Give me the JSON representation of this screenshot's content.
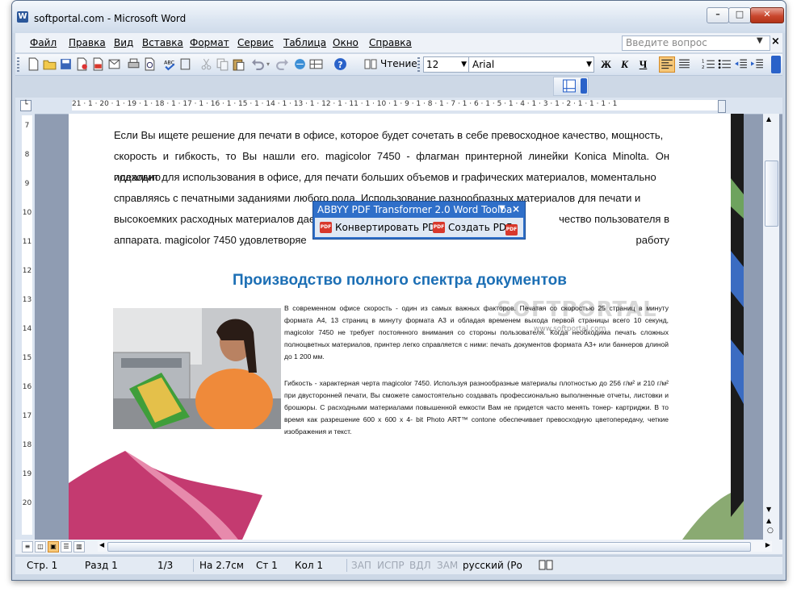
{
  "window": {
    "title": "softportal.com - Microsoft Word",
    "app_icon": "W"
  },
  "caption_buttons": {
    "minimize": "–",
    "maximize": "□",
    "close": "✕"
  },
  "menu": {
    "items": [
      "Файл",
      "Правка",
      "Вид",
      "Вставка",
      "Формат",
      "Сервис",
      "Таблица",
      "Окно",
      "Справка"
    ],
    "help_placeholder": "Введите вопрос",
    "close_doc": "×"
  },
  "toolbar": {
    "reading_label": "Чтение",
    "font_size": "12",
    "font_name": "Arial",
    "bold": "Ж",
    "italic": "К",
    "underline": "Ч"
  },
  "ruler": {
    "h_scale": "21 · 1 · 20 · 1 · 19 · 1 · 18 · 1 · 17 · 1 · 16 · 1 · 15 · 1 · 14 · 1 · 13 · 1 · 12 · 1 · 11 · 1 · 10 · 1 · 9 · 1 · 8 · 1 · 7 · 1 · 6 · 1 · 5 · 1 · 4 · 1 · 3 · 1 · 2 · 1 · 1 · 1 · 1",
    "v_numbers": [
      "7",
      "8",
      "9",
      "10",
      "11",
      "12",
      "13",
      "14",
      "15",
      "16",
      "17",
      "18",
      "19",
      "20"
    ]
  },
  "document": {
    "paragraph_lines": [
      "Если Вы ищете решение для печати в офисе, которое будет сочетать в себе превосходное качество, мощность,",
      "скорость и гибкость, то Вы нашли его. magicolor 7450 - флагман принтерной линейки Konica Minolta. Он идеально",
      "подходит для использования в офисе, для печати больших объемов и графических материалов, моментально",
      "справляясь с печатными заданиями любого рода. Использование разнообразных материалов для печати и",
      "высокоемких расходных материалов дает",
      "аппарата. magicolor 7450 удовлетворяе"
    ],
    "line5_tail": "чество пользователя в работу",
    "heading": "Производство полного спектра документов",
    "small_par1": "В современном офисе скорость - один из самых важных факторов. Печатая со скоростью 25 страниц в минуту формата A4, 13 страниц в минуту формата A3 и обладая временем выхода первой страницы всего 10 секунд, magicolor 7450 не требует постоянного внимания со стороны пользователя. Когда необходима печать сложных полноцветных материалов, принтер легко справляется с ними: печать документов формата A3+ или баннеров длиной до 1 200 мм.",
    "small_par2": "Гибкость - характерная черта magicolor 7450. Используя разнообразные материалы плотностью до 256 г/м² и 210 г/м² при двусторонней печати, Вы сможете самостоятельно создавать профессионально выполненные отчеты, листовки и брошюры. С расходными материалами повышенной емкости Вам не придется часто менять тонер- картриджи. В то время как разрешение 600 x 600 x 4- bit Photo ART™ contone обеспечивает превосходную цветопередачу, четкие изображения и текст."
  },
  "abbyy_toolbar": {
    "title": "ABBYY PDF Transformer 2.0 Word Toolba",
    "convert_label": "Конвертировать PDF",
    "create_label": "Создать PDF",
    "pdf_icon_text": "PDF"
  },
  "watermark": {
    "text": "SOFTPORTAL",
    "url": "www.softportal.com"
  },
  "status": {
    "page": "Стр. 1",
    "section": "Разд 1",
    "pages": "1/3",
    "at": "На 2.7см",
    "line": "Ст 1",
    "col": "Кол 1",
    "rec": "ЗАП",
    "trk": "ИСПР",
    "ext": "ВДЛ",
    "ovr": "ЗАМ",
    "language": "русский (Ро"
  },
  "colors": {
    "heading": "#1c6fb5",
    "abbyy_title_bg": "#2f6fc9",
    "close_button": "#c9472e"
  }
}
